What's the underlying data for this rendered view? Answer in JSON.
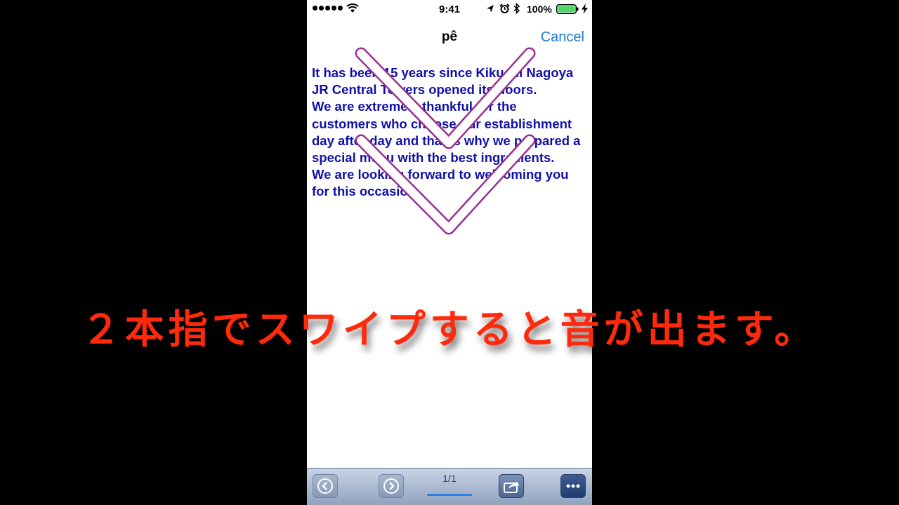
{
  "status_bar": {
    "time": "9:41",
    "battery_percent": "100%",
    "signal_dots": 5,
    "icons": [
      "wifi-icon",
      "location-icon",
      "alarm-icon",
      "bluetooth-icon",
      "battery-icon",
      "charging-icon"
    ]
  },
  "nav": {
    "title": "pê",
    "cancel_label": "Cancel"
  },
  "body": {
    "paragraphs": [
      "It has been 15 years since Kikuchi Nagoya JR Central Towers opened its doors.",
      "We are extremely thankful for the customers who choose our establishment day after day and that is why we prepared a special menu with the best ingredients.",
      "We are looking forward to welcoming you for this occasion."
    ]
  },
  "toolbar": {
    "page_indicator": "1/1",
    "buttons": [
      "prev-icon",
      "next-icon",
      "share-icon",
      "more-icon"
    ]
  },
  "caption": "２本指でスワイプすると音が出ます。",
  "colors": {
    "accent": "#1a7ad8",
    "body_text": "#1010a8",
    "caption": "#ff2a0c",
    "background": "#000000"
  }
}
